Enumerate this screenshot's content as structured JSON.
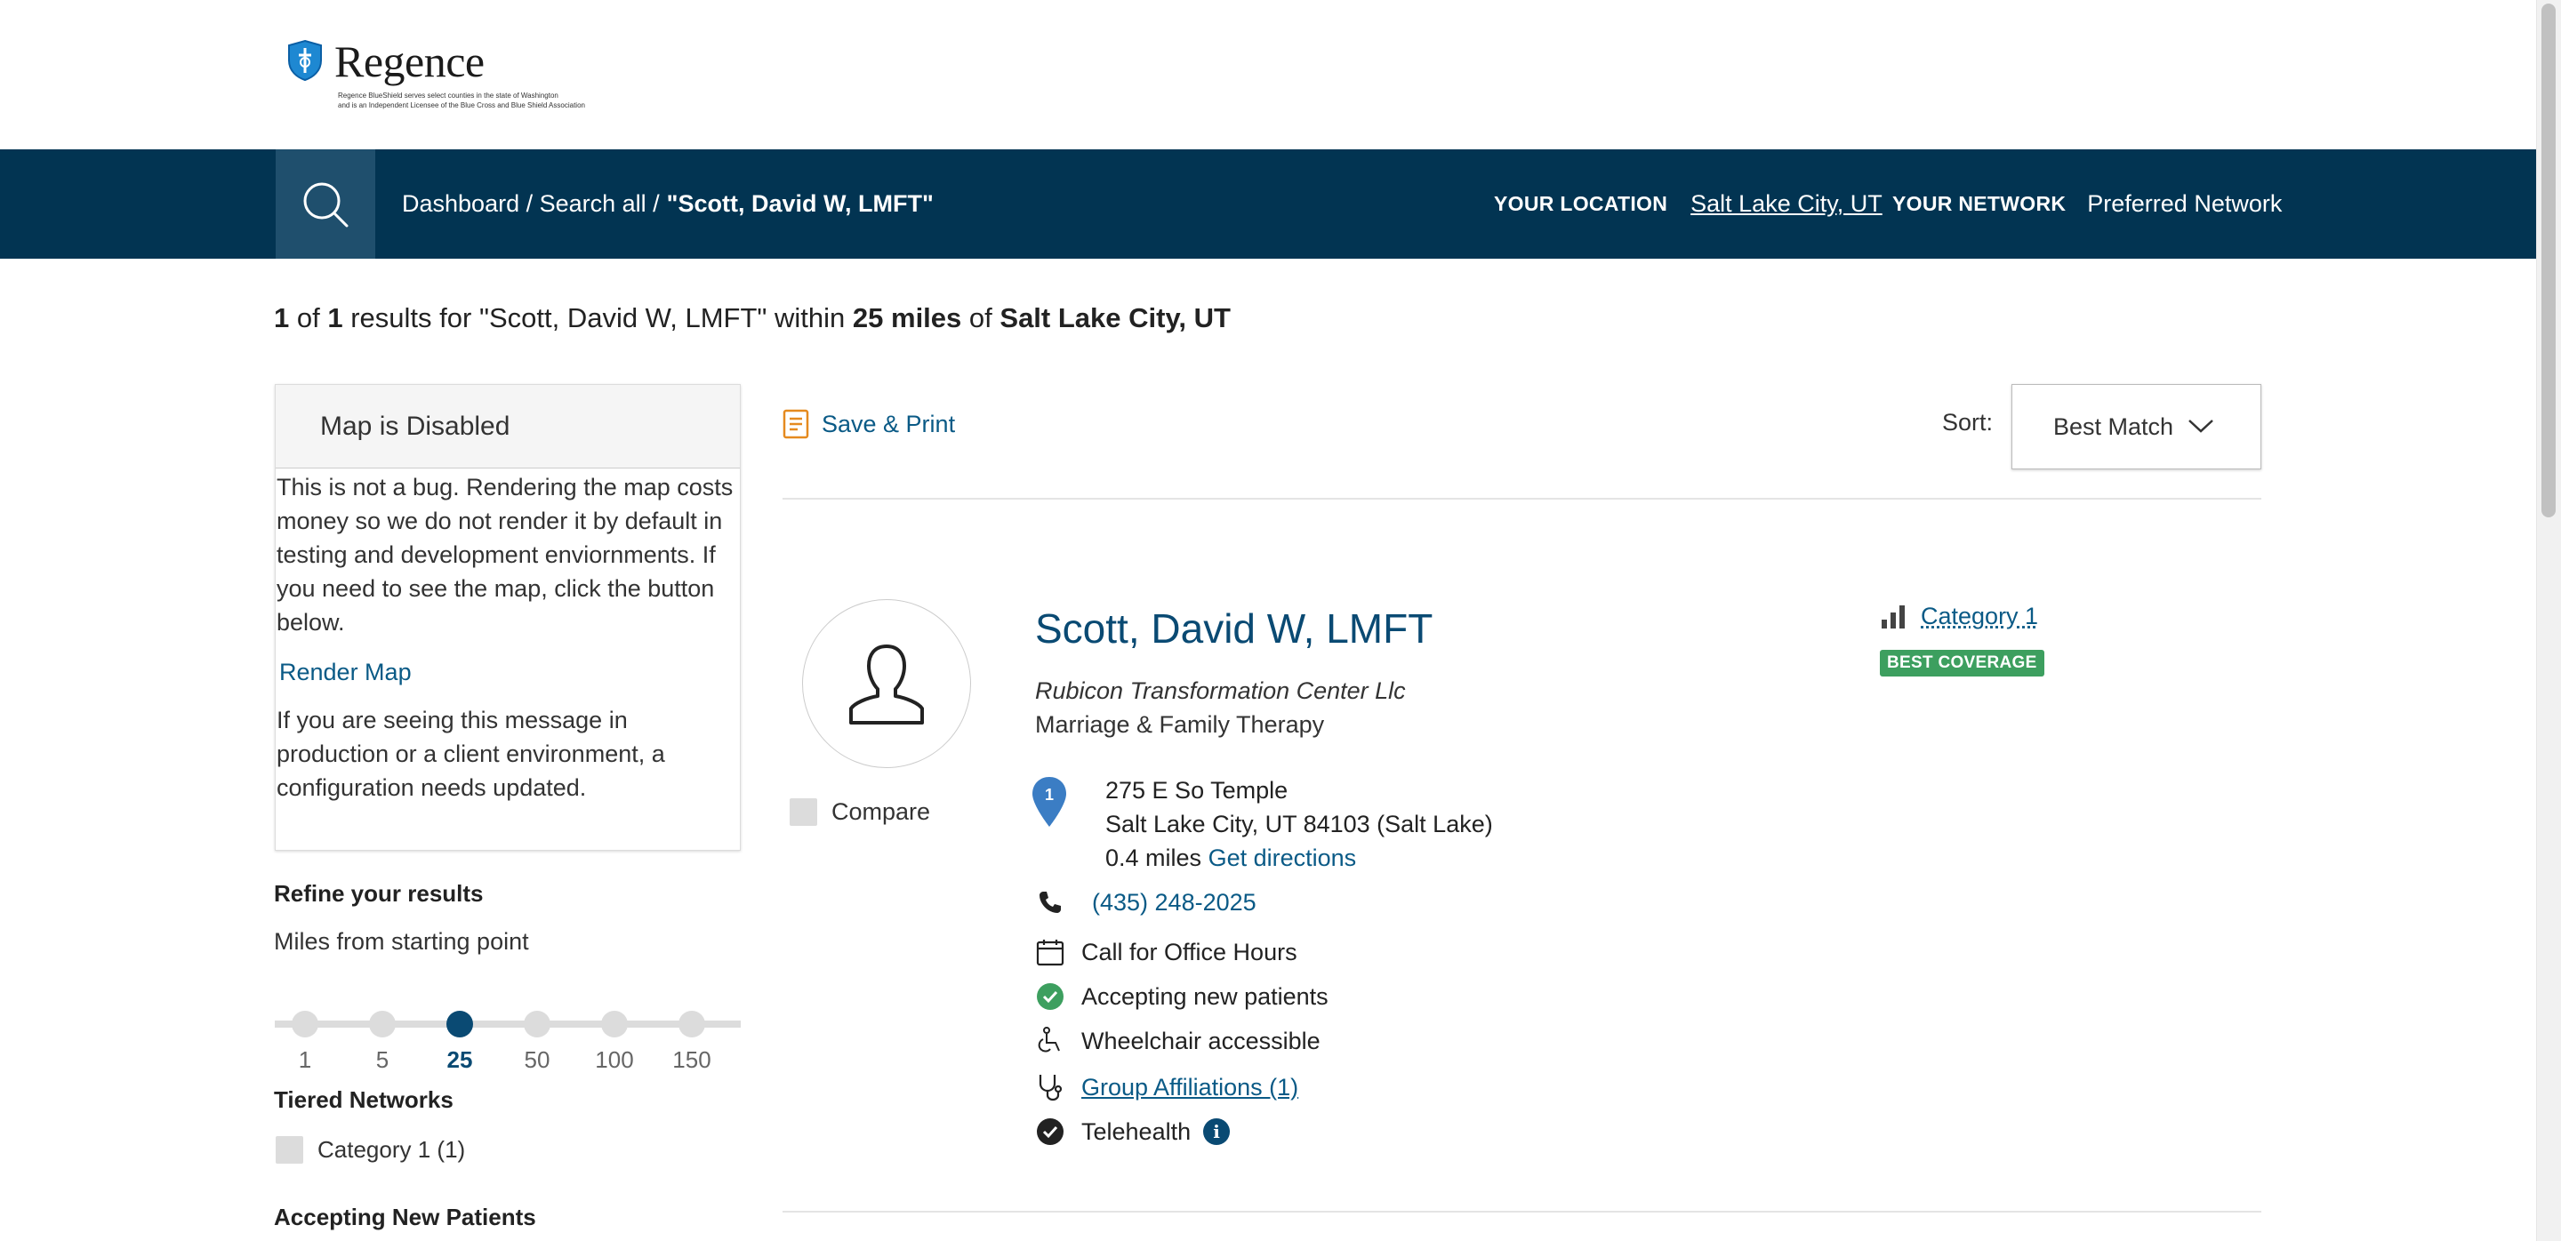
{
  "header": {
    "brand": "Regence",
    "fine_print_line1": "Regence BlueShield serves select counties in the state of Washington",
    "fine_print_line2": "and is an Independent Licensee of the Blue Cross and Blue Shield Association"
  },
  "nav": {
    "breadcrumb_prefix": "Dashboard / Search all /",
    "breadcrumb_current": "\"Scott, David W, LMFT\"",
    "location_label": "YOUR LOCATION",
    "location_value": "Salt Lake City, UT",
    "network_label": "YOUR NETWORK",
    "network_value": "Preferred Network",
    "colors": {
      "bar": "#023452",
      "search_button": "#1f4f6d"
    }
  },
  "results": {
    "count": "1",
    "of_word": "of",
    "total": "1",
    "text_for": "results for \"Scott, David W, LMFT\" within",
    "distance": "25 miles",
    "of_word2": "of",
    "place": "Salt Lake City, UT"
  },
  "map_panel": {
    "title": "Map is Disabled",
    "message": "This is not a bug. Rendering the map costs money so we do not render it by default in testing and development enviornments. If you need to see the map, click the button below.",
    "render_link": "Render Map",
    "footer": "If you are seeing this message in production or a client environment, a configuration needs updated."
  },
  "refine": {
    "title": "Refine your results",
    "miles_label": "Miles from starting point",
    "miles_options": [
      "1",
      "5",
      "25",
      "50",
      "100",
      "150"
    ],
    "miles_selected": "25",
    "tiered_title": "Tiered Networks",
    "tiered_option": "Category 1 (1)",
    "accepting_title": "Accepting New Patients"
  },
  "toolbar": {
    "save_print": "Save & Print",
    "sort_label": "Sort:",
    "sort_value": "Best Match"
  },
  "provider": {
    "name": "Scott, David W, LMFT",
    "organization": "Rubicon Transformation Center Llc",
    "specialty": "Marriage & Family Therapy",
    "pin_number": "1",
    "address_line1": "275 E So Temple",
    "address_line2": "Salt Lake City, UT 84103 (Salt Lake)",
    "distance": "0.4 miles",
    "directions": "Get directions",
    "phone": "(435) 248-2025",
    "office_hours": "Call for Office Hours",
    "accepting": "Accepting new patients",
    "wheelchair": "Wheelchair accessible",
    "affiliations": "Group Affiliations (1)",
    "telehealth": "Telehealth",
    "info_glyph": "i",
    "compare_label": "Compare",
    "category": "Category 1",
    "badge": "BEST COVERAGE",
    "colors": {
      "name": "#0a4a73",
      "badge": "#3d9f5f",
      "accepting_check": "#3d9f5f"
    }
  }
}
